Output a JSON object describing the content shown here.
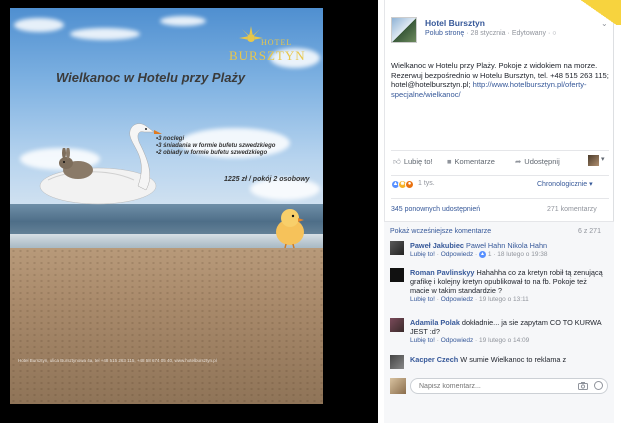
{
  "image": {
    "logo_word": "BURSZTYN",
    "logo_small": "HOTEL",
    "headline": "Wielkanoc w Hotelu przy Plaży",
    "offer_items": [
      "3 noclegi",
      "3 śniadania w formie bufetu szwedzkiego",
      "2 obiady w formie bufetu szwedzkiego"
    ],
    "price": "1225 zł / pokój 2 osobowy",
    "fineprint": "Hotel Bursztyn, ulica Bursztynowa 4a, tel +48 515 263 115, +48 58 674 05 40, www.hotelbursztyn.pl"
  },
  "post": {
    "page_name": "Hotel Bursztyn",
    "like_page": "Polub stronę",
    "date": "28 stycznia",
    "edited": "Edytowany",
    "privacy_icon": "globe-icon",
    "text_plain": "Wielkanoc w Hotelu przy Plaży. Pokoje z widokiem na morze. Rezerwuj bezpośrednio w Hotelu Bursztyn, tel. +48 515 263 115; hotel@hotelbursztyn.pl;",
    "link": "http://www.hotelbursztyn.pl/oferty-specjalne/wielkanoc/"
  },
  "actions": {
    "like": "Lubię to!",
    "comment": "Komentarze",
    "share": "Udostępnij"
  },
  "reactions": {
    "count": "1 tys.",
    "sort": "Chronologicznie"
  },
  "stats": {
    "shares": "345 ponownych udostępnień",
    "comments": "271 komentarzy"
  },
  "comments_section": {
    "previous_label": "Pokaż wcześniejsze komentarze",
    "previous_count": "6 z 271",
    "input_placeholder": "Napisz komentarz...",
    "items": [
      {
        "author": "Paweł Jakubiec",
        "text": "Paweł Hahn Nikola Hahn",
        "like": "Lubię to!",
        "reply": "Odpowiedz",
        "likes": "1",
        "time": "18 lutego o 19:38"
      },
      {
        "author": "Roman Pavlinskyy",
        "text": "Hahahha co za kretyn robił tą zenującą grafikę i kolejny kretyn opublikował to na fb. Pokoje też macie w takim standardzie ?",
        "like": "Lubię to!",
        "reply": "Odpowiedz",
        "time": "19 lutego o 13:11"
      },
      {
        "author": "Adamila Polak",
        "text": "dokładnie... ja sie zapytam CO TO KURWA JEST :d?",
        "like": "Lubię to!",
        "reply": "Odpowiedz",
        "time": "19 lutego o 14:09"
      },
      {
        "author": "Kacper Czech",
        "text": "W sumie Wielkanoc to reklama z"
      }
    ]
  },
  "colors": {
    "fb_link": "#365899",
    "fb_gray": "#90949c",
    "logo_gold": "#e8c74a",
    "accent_yellow": "#f7d33e"
  }
}
